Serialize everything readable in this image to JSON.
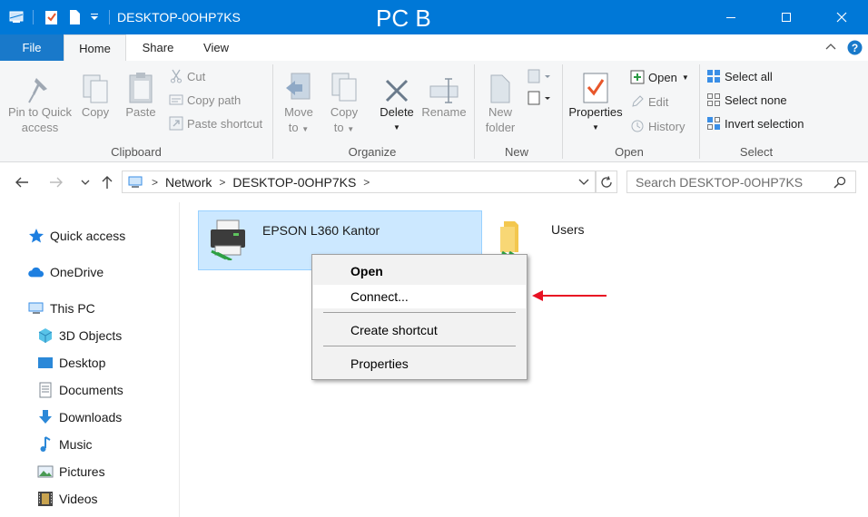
{
  "window": {
    "title": "DESKTOP-0OHP7KS",
    "overlay_label": "PC B"
  },
  "tabs": {
    "file": "File",
    "home": "Home",
    "share": "Share",
    "view": "View"
  },
  "ribbon": {
    "clipboard": {
      "label": "Clipboard",
      "pin_line1": "Pin to Quick",
      "pin_line2": "access",
      "copy": "Copy",
      "paste": "Paste",
      "cut": "Cut",
      "copy_path": "Copy path",
      "paste_shortcut": "Paste shortcut"
    },
    "organize": {
      "label": "Organize",
      "move_line1": "Move",
      "move_line2": "to",
      "copy_line1": "Copy",
      "copy_line2": "to",
      "delete": "Delete",
      "rename": "Rename"
    },
    "new": {
      "label": "New",
      "new_line1": "New",
      "new_line2": "folder"
    },
    "open": {
      "label": "Open",
      "properties": "Properties",
      "open": "Open",
      "edit": "Edit",
      "history": "History"
    },
    "select": {
      "label": "Select",
      "select_all": "Select all",
      "select_none": "Select none",
      "invert": "Invert selection"
    }
  },
  "address": {
    "crumbs": [
      "Network",
      "DESKTOP-0OHP7KS"
    ],
    "search_placeholder": "Search DESKTOP-0OHP7KS"
  },
  "nav": {
    "quick_access": "Quick access",
    "onedrive": "OneDrive",
    "this_pc": "This PC",
    "objects3d": "3D Objects",
    "desktop": "Desktop",
    "documents": "Documents",
    "downloads": "Downloads",
    "music": "Music",
    "pictures": "Pictures",
    "videos": "Videos"
  },
  "items": [
    {
      "name": "EPSON L360 Kantor",
      "icon": "printer-icon"
    },
    {
      "name": "Users",
      "icon": "shared-folder-icon"
    }
  ],
  "context_menu": {
    "open": "Open",
    "connect": "Connect...",
    "create_shortcut": "Create shortcut",
    "properties": "Properties"
  },
  "colors": {
    "titlebar": "#0078d7",
    "file_tab": "#1979ca",
    "selection": "#cce8ff",
    "arrow": "#e81123"
  }
}
